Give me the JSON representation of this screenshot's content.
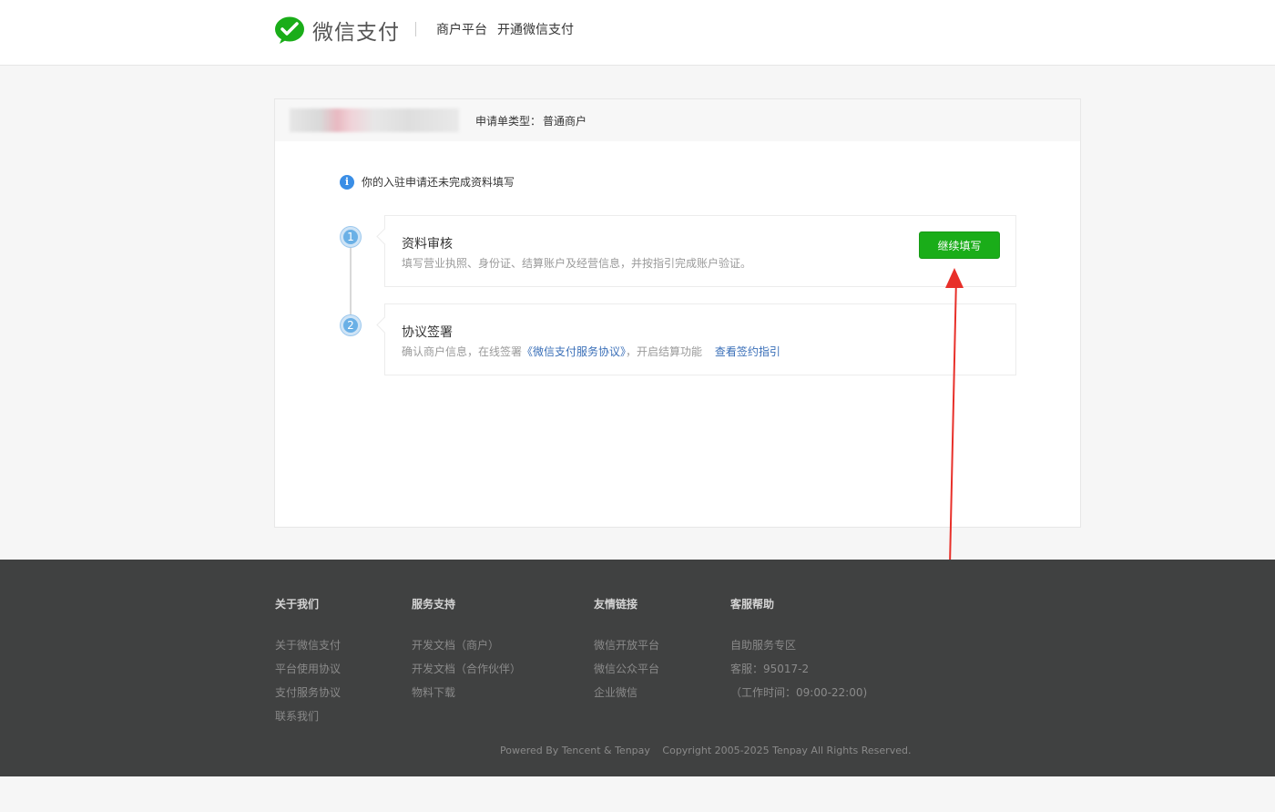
{
  "header": {
    "brand": "微信支付",
    "nav": [
      "商户平台",
      "开通微信支付"
    ]
  },
  "application": {
    "type_label": "申请单类型：",
    "type_value": "普通商户",
    "notice": "你的入驻申请还未完成资料填写"
  },
  "steps": [
    {
      "num": "1",
      "title": "资料审核",
      "desc": "填写营业执照、身份证、结算账户及经营信息，并按指引完成账户验证。",
      "button": "继续填写"
    },
    {
      "num": "2",
      "title": "协议签署",
      "desc_prefix": "确认商户信息，在线签署",
      "agreement_link": "《微信支付服务协议》",
      "desc_suffix": "，开启结算功能",
      "guide_link": "查看签约指引"
    }
  ],
  "footer": {
    "columns": [
      {
        "title": "关于我们",
        "items": [
          "关于微信支付",
          "平台使用协议",
          "支付服务协议",
          "联系我们"
        ]
      },
      {
        "title": "服务支持",
        "items": [
          "开发文档（商户）",
          "开发文档（合作伙伴）",
          "物料下载"
        ]
      },
      {
        "title": "友情链接",
        "items": [
          "微信开放平台",
          "微信公众平台",
          "企业微信"
        ]
      },
      {
        "title": "客服帮助",
        "items": [
          "自助服务专区",
          "客服：95017-2",
          "（工作时间：09:00-22:00)"
        ]
      }
    ],
    "powered": "Powered By Tencent & Tenpay",
    "copyright": "Copyright 2005-2025 Tenpay All Rights Reserved."
  },
  "colors": {
    "brand_green": "#1aad19",
    "link_blue": "#3a6fb8",
    "annotation_red": "#e8302a",
    "footer_bg": "#404141"
  }
}
